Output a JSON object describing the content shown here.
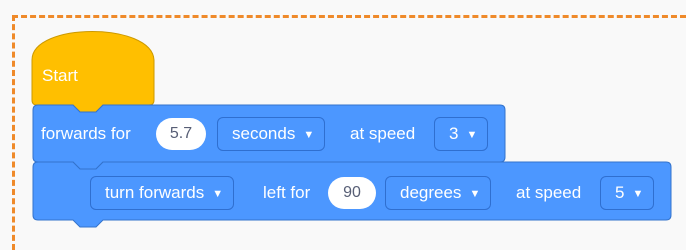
{
  "start_block": {
    "label": "Start",
    "color": "#ffbf00"
  },
  "motor_block": {
    "text_forwards_for": "forwards for",
    "duration_value": "5.7",
    "unit_dropdown": "seconds",
    "text_at_speed": "at speed",
    "speed_dropdown": "3",
    "color": "#4c97ff"
  },
  "turn_block": {
    "direction_dropdown": "turn forwards",
    "text_left_for": "left for",
    "angle_value": "90",
    "unit_dropdown": "degrees",
    "text_at_speed": "at speed",
    "speed_dropdown": "5"
  },
  "icons": {
    "dropdown": "caret-down-icon"
  },
  "colors": {
    "workspace_border": "#ef8a2a",
    "block_blue": "#4c97ff",
    "block_dark_outline": "#2f6fd0"
  }
}
